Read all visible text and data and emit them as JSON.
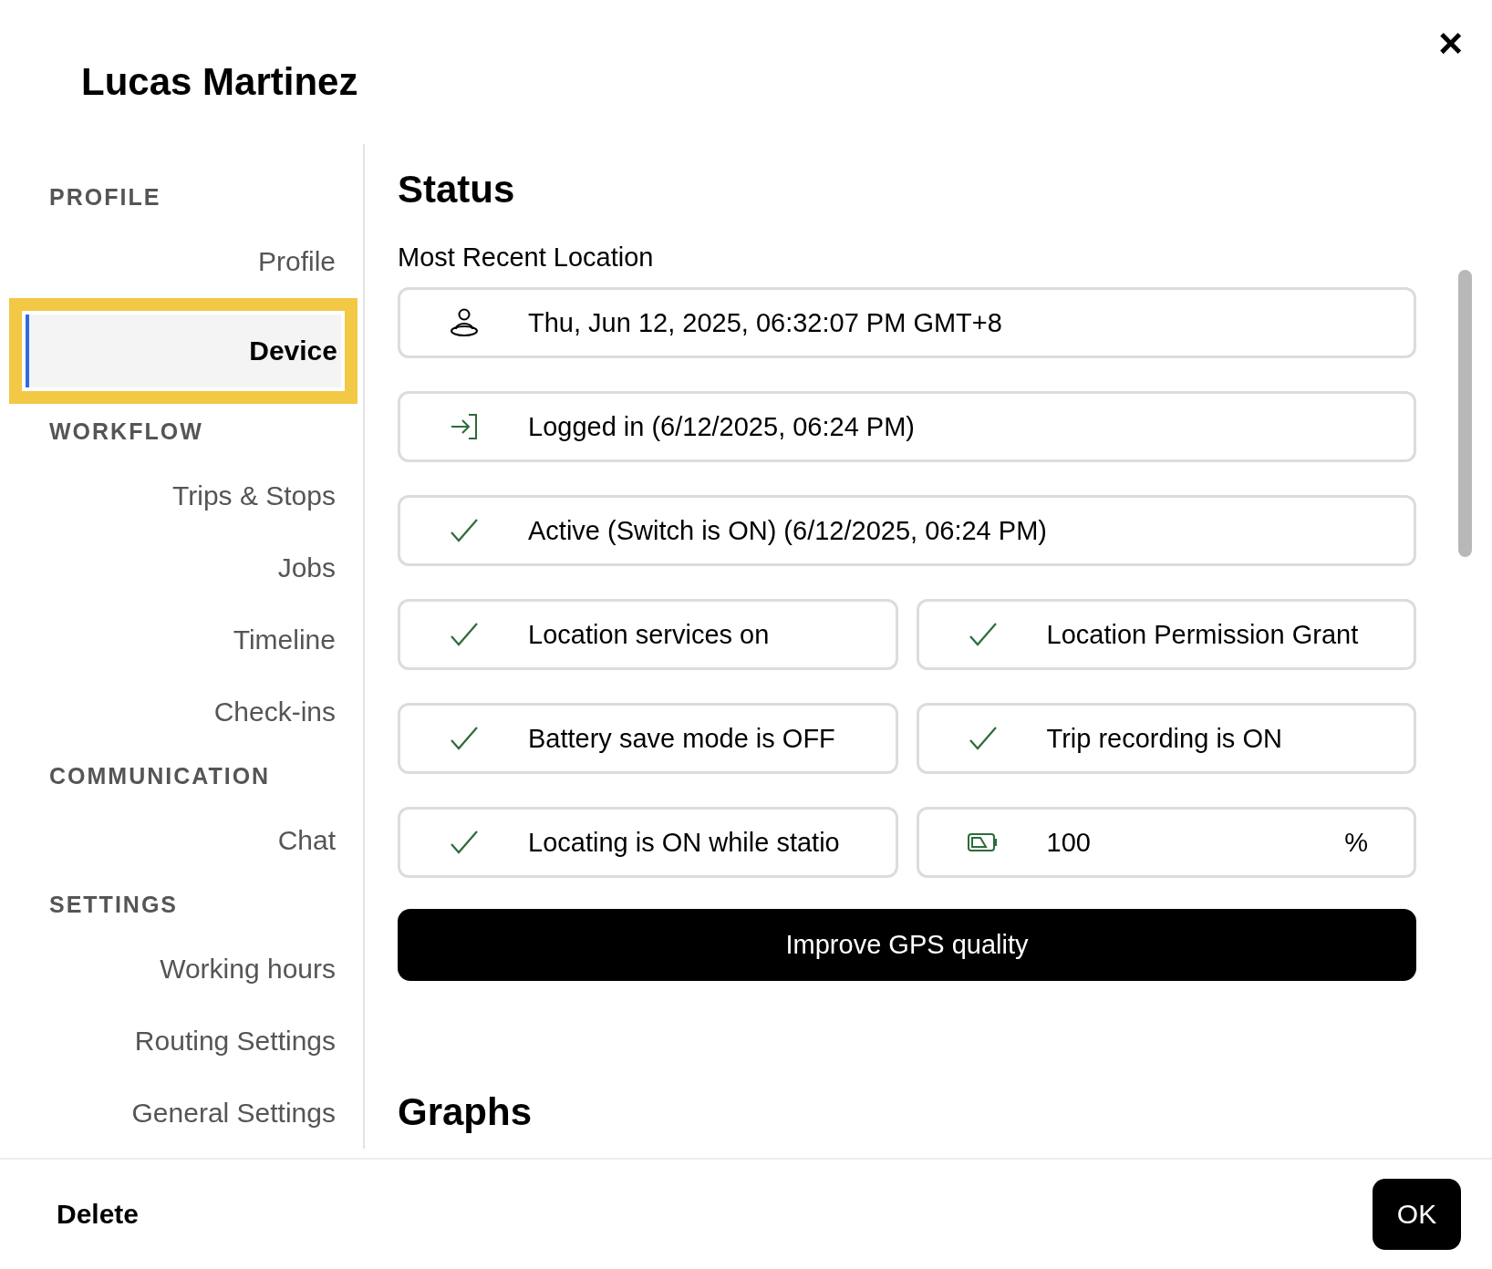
{
  "dialog": {
    "title": "Lucas Martinez",
    "close_label": "×"
  },
  "sidebar": {
    "sections": [
      {
        "heading": "PROFILE",
        "items": [
          {
            "label": "Profile",
            "selected": false,
            "highlighted": false
          },
          {
            "label": "Device",
            "selected": true,
            "highlighted": true
          }
        ]
      },
      {
        "heading": "WORKFLOW",
        "items": [
          {
            "label": "Trips & Stops",
            "selected": false,
            "highlighted": false
          },
          {
            "label": "Jobs",
            "selected": false,
            "highlighted": false
          },
          {
            "label": "Timeline",
            "selected": false,
            "highlighted": false
          },
          {
            "label": "Check-ins",
            "selected": false,
            "highlighted": false
          }
        ]
      },
      {
        "heading": "COMMUNICATION",
        "items": [
          {
            "label": "Chat",
            "selected": false,
            "highlighted": false
          }
        ]
      },
      {
        "heading": "SETTINGS",
        "items": [
          {
            "label": "Working hours",
            "selected": false,
            "highlighted": false
          },
          {
            "label": "Routing Settings",
            "selected": false,
            "highlighted": false
          },
          {
            "label": "General Settings",
            "selected": false,
            "highlighted": false
          }
        ]
      }
    ]
  },
  "status": {
    "heading": "Status",
    "subheading": "Most Recent Location",
    "lines": [
      {
        "items": [
          {
            "kind": "person",
            "text": "Thu, Jun 12, 2025, 06:32:07 PM GMT+8"
          }
        ]
      },
      {
        "items": [
          {
            "kind": "login",
            "text": "Logged in (6/12/2025, 06:24 PM)"
          }
        ]
      },
      {
        "items": [
          {
            "kind": "check",
            "text": "Active (Switch is ON) (6/12/2025, 06:24 PM)"
          }
        ]
      },
      {
        "items": [
          {
            "kind": "check",
            "text": "Location services on"
          },
          {
            "kind": "check",
            "text": "Location Permission Grant"
          }
        ]
      },
      {
        "items": [
          {
            "kind": "check",
            "text": "Battery save mode is OFF"
          },
          {
            "kind": "check",
            "text": "Trip recording is ON"
          }
        ]
      },
      {
        "items": [
          {
            "kind": "check",
            "text": "Locating is ON while statio"
          },
          {
            "kind": "battery",
            "text": "100",
            "unit": "%"
          }
        ]
      }
    ],
    "action": "Improve GPS quality"
  },
  "graphs": {
    "heading": "Graphs"
  },
  "footer": {
    "delete": "Delete",
    "ok": "OK"
  }
}
